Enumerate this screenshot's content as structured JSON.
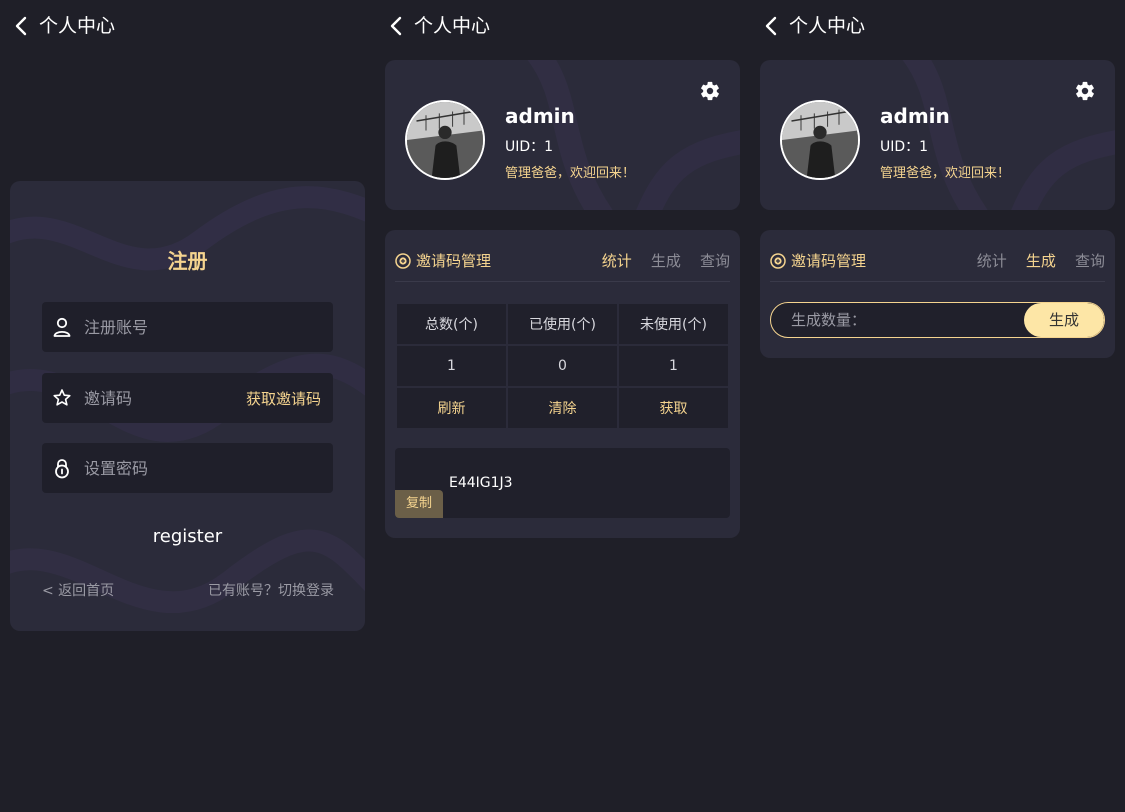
{
  "colors": {
    "background": "#1f1f28",
    "card": "#2b2b3a",
    "accent": "#f5d48f",
    "field": "#1f1f2a",
    "muted": "#9a9aa4",
    "copy_button": "#6b5f48",
    "generate_button": "#fde6a6"
  },
  "header": {
    "title": "个人中心"
  },
  "register": {
    "title": "注册",
    "username_placeholder": "注册账号",
    "invite_placeholder": "邀请码",
    "get_invite_label": "获取邀请码",
    "password_placeholder": "设置密码",
    "submit_label": "register",
    "back_home_label": "< 返回首页",
    "switch_login_label": "已有账号？切换登录"
  },
  "profile": {
    "username": "admin",
    "uid": "UID：1",
    "welcome": "管理爸爸，欢迎回来！"
  },
  "invite": {
    "title": "邀请码管理",
    "tabs": [
      "统计",
      "生成",
      "查询"
    ],
    "stats": {
      "headers": [
        "总数(个)",
        "已使用(个)",
        "未使用(个)"
      ],
      "values": [
        "1",
        "0",
        "1"
      ],
      "actions": [
        "刷新",
        "清除",
        "获取"
      ]
    },
    "code": "E44IG1J3",
    "copy_label": "复制",
    "generate_placeholder": "生成数量：",
    "generate_label": "生成"
  },
  "icons": {
    "back": "chevron-left-icon",
    "user": "user-icon",
    "invite": "star-icon",
    "password": "lock-icon",
    "settings": "gear-icon",
    "invite_badge": "invite-badge-icon"
  }
}
